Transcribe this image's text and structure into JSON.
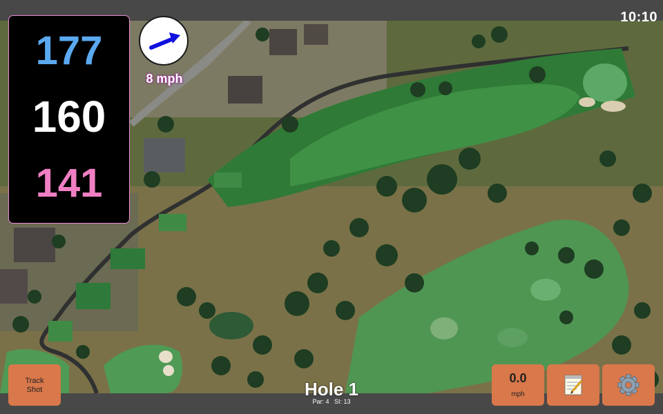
{
  "status": {
    "clock": "10:10"
  },
  "distances": {
    "back": "177",
    "middle": "160",
    "front": "141"
  },
  "wind": {
    "speed": "8 mph",
    "direction_icon": "wind-arrow-icon"
  },
  "hole": {
    "title": "Hole 1",
    "par_label": "Par: 4",
    "si_label": "SI: 13"
  },
  "buttons": {
    "track_shot_line1": "Track",
    "track_shot_line2": "Shot",
    "speed_value": "0.0",
    "speed_unit": "mph",
    "notes_icon": "notepad-icon",
    "settings_icon": "gear-icon"
  },
  "colors": {
    "back_distance": "#5aa9f0",
    "middle_distance": "#ffffff",
    "front_distance": "#ef7fc2",
    "button_bg": "#d9784a",
    "bar_bg": "#484848"
  }
}
